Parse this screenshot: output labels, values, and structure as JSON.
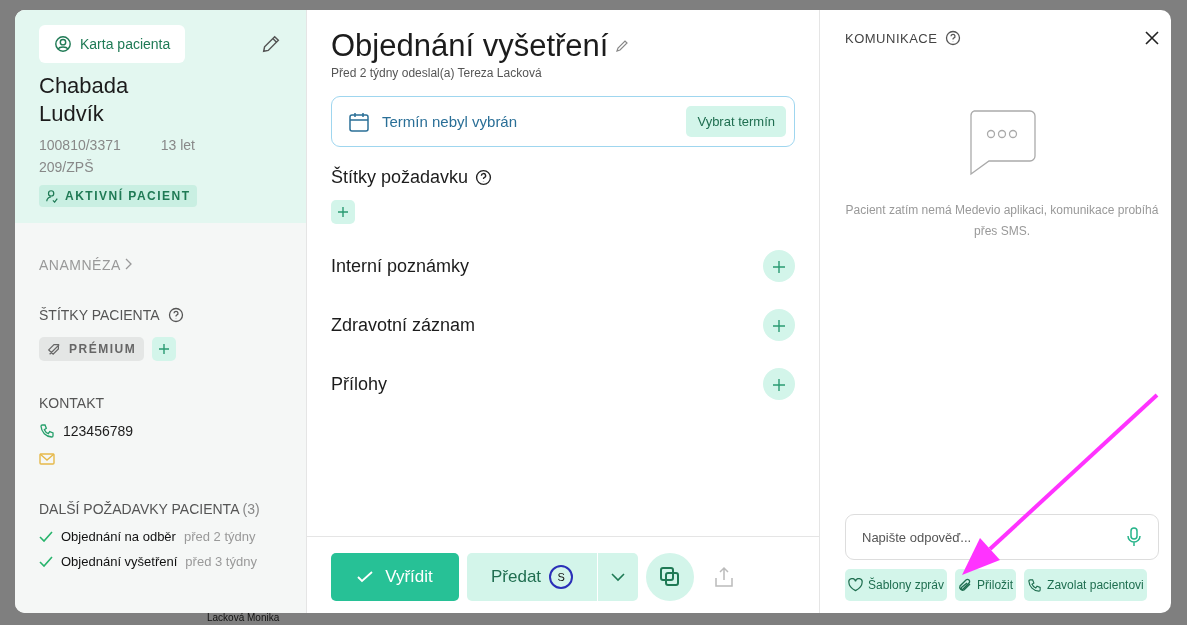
{
  "background": {
    "text": "Lacková Monika"
  },
  "patient_panel": {
    "card_button": "Karta pacienta",
    "surname": "Chabada",
    "first_name": "Ludvík",
    "id_number": "100810/3371",
    "age": "13 let",
    "insurance": "209/ZPŠ",
    "status": "AKTIVNÍ PACIENT",
    "anamnesis_link": "ANAMNÉZA",
    "tags_heading": "ŠTÍTKY PACIENTA",
    "tags": [
      {
        "label": "PRÉMIUM"
      }
    ],
    "contact_heading": "KONTAKT",
    "phone": "123456789",
    "other_requests_heading": "DALŠÍ POŽADAVKY PACIENTA",
    "other_requests_count": "(3)",
    "other_requests": [
      {
        "title": "Objednání na odběr",
        "time": "před 2 týdny",
        "done": true
      },
      {
        "title": "Objednání vyšetření",
        "time": "před 3 týdny",
        "done": true
      }
    ]
  },
  "request": {
    "title": "Objednání vyšetření",
    "subtitle": "Před 2 týdny odeslal(a) Tereza Lacková",
    "appointment": {
      "text": "Termín nebyl vybrán",
      "button": "Vybrat termín"
    },
    "tags_heading": "Štítky požadavku",
    "sections": [
      {
        "title": "Interní poznámky"
      },
      {
        "title": "Zdravotní záznam"
      },
      {
        "title": "Přílohy"
      }
    ],
    "actions": {
      "resolve": "Vyřídit",
      "handover": "Předat",
      "handover_avatar": "S"
    }
  },
  "communication": {
    "title": "KOMUNIKACE",
    "empty_message": "Pacient zatím nemá Medevio aplikaci, komunikace probíhá přes SMS.",
    "reply": {
      "placeholder": "Napište odpověď..."
    },
    "quick_actions": [
      {
        "kind": "templates",
        "label": "Šablony zpráv"
      },
      {
        "kind": "attach",
        "label": "Přiložit"
      },
      {
        "kind": "call",
        "label": "Zavolat pacientovi"
      }
    ]
  }
}
